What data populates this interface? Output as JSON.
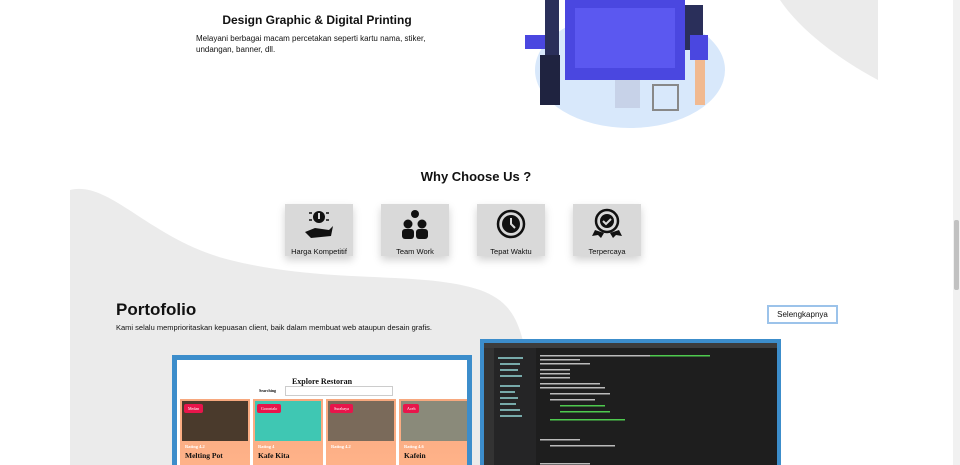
{
  "service": {
    "title": "Design Graphic & Digital Printing",
    "description": "Melayani berbagai macam percetakan seperti kartu nama, stiker, undangan, banner, dll."
  },
  "why": {
    "title": "Why Choose Us ?",
    "items": [
      {
        "label": "Harga Kompetitif",
        "icon": "price-hand-icon"
      },
      {
        "label": "Team Work",
        "icon": "team-icon"
      },
      {
        "label": "Tepat Waktu",
        "icon": "clock-icon"
      },
      {
        "label": "Terpercaya",
        "icon": "badge-check-icon"
      }
    ]
  },
  "portfolio": {
    "title": "Portofolio",
    "description": "Kami selalu memprioritaskan kepuasan client, baik dalam membuat web ataupun desain grafis.",
    "button": "Selengkapnya",
    "project1": {
      "title": "Explore Restoran",
      "search_label": "Searching",
      "cards": [
        {
          "tag": "Medan",
          "rating": "Rating 4.2",
          "name": "Melting Pot",
          "color": "#4a3a2c"
        },
        {
          "tag": "Gorontalo",
          "rating": "Rating 4",
          "name": "Kafe Kita",
          "color": "#3fc7b3"
        },
        {
          "tag": "Surabaya",
          "rating": "Rating 4.2",
          "name": "",
          "color": "#7a6a5a"
        },
        {
          "tag": "Aceh",
          "rating": "Rating 4.6",
          "name": "Kafein",
          "color": "#8a8a7a"
        }
      ]
    }
  },
  "colors": {
    "accent": "#3c8dcb",
    "bg_shape": "#ebebeb"
  }
}
